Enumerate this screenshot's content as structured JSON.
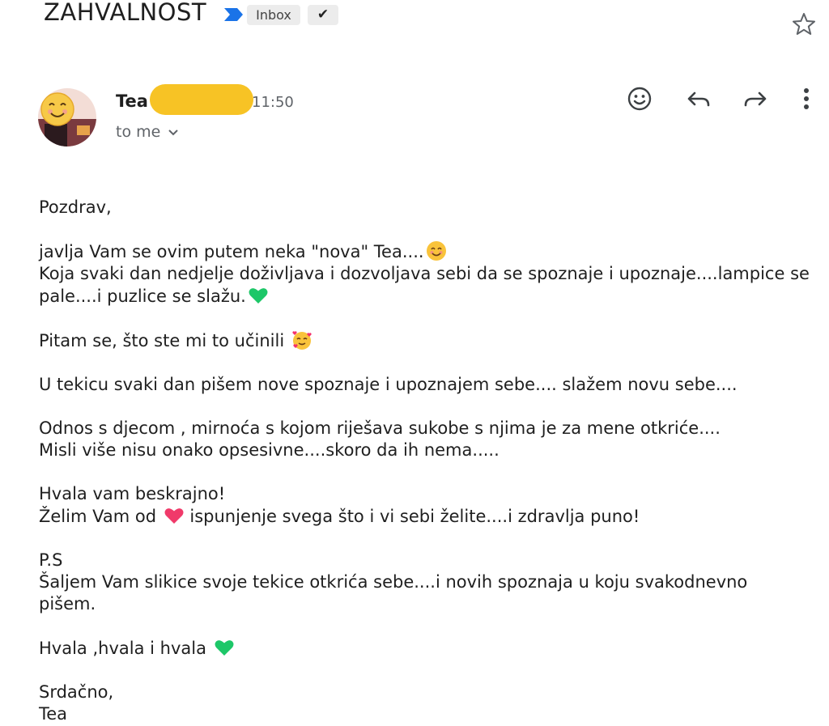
{
  "header": {
    "subject": "ZAHVALNOST",
    "labels": [
      "Inbox",
      "✔"
    ],
    "star_icon": "star-outline-icon",
    "importance_icon": "importance-marker-icon",
    "importance_color": "#1a73e8"
  },
  "sender": {
    "name": "Tea",
    "time": "11:50",
    "recipient": "to me",
    "avatar_icon": "smiling-face-avatar",
    "redaction_color": "#f7c325"
  },
  "actions": [
    {
      "icon": "emoji-react-icon"
    },
    {
      "icon": "reply-icon"
    },
    {
      "icon": "forward-icon"
    },
    {
      "icon": "more-vert-icon"
    }
  ],
  "body": {
    "greeting": "Pozdrav,",
    "p1_line1": "javlja Vam se ovim putem neka \"nova\" Tea....",
    "p1_line2": "Koja svaki dan nedjelje doživljava i dozvoljava sebi da se spoznaje i upoznaje....lampice se",
    "p1_line3": "pale....i puzlice se slažu.",
    "p2": "Pitam se, što ste mi to učinili ",
    "p3": "U tekicu svaki dan pišem nove spoznaje i upoznajem sebe.... slažem novu sebe....",
    "p4_line1": "Odnos s djecom , mirnoća s kojom riješava sukobe s njima je za mene otkriće....",
    "p4_line2": "Misli više nisu onako opsesivne....skoro da ih nema.....",
    "p5_line1": "Hvala vam beskrajno!",
    "p5_line2_a": "Želim Vam od ",
    "p5_line2_b": " ispunjenje svega što i vi sebi želite....i zdravlja puno!",
    "ps_label": "P.S",
    "ps_line1": "Šaljem Vam slikice svoje tekice otkrića sebe....i novih spoznaja u koju svakodnevno",
    "ps_line2": "pišem.",
    "thanks": "Hvala ,hvala i hvala ",
    "closing": "Srdačno,",
    "signature": "Tea"
  },
  "emojis": [
    "smiling-face",
    "green-heart",
    "smiling-face-with-hearts",
    "pink-heart",
    "green-heart"
  ]
}
